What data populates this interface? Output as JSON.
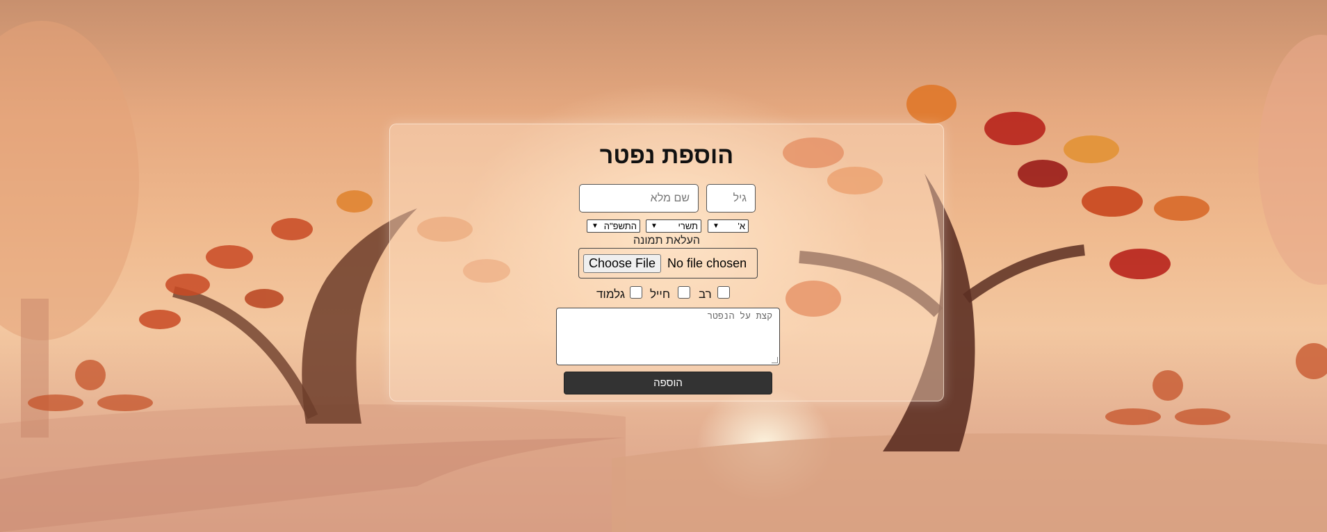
{
  "form": {
    "title": "הוספת נפטר",
    "full_name_placeholder": "שם מלא",
    "age_placeholder": "גיל",
    "day_value": "א'",
    "month_value": "תשרי",
    "year_value": "התשפ\"ה",
    "upload_label": "העלאת תמונה",
    "file_button_label": "Choose File",
    "file_status": "No file chosen",
    "checkbox_rav_label": "רב",
    "checkbox_soldier_label": "חייל",
    "checkbox_galmud_label": "גלמוד",
    "about_placeholder": "קצת על הנפטר",
    "submit_label": "הוספה"
  },
  "colors": {
    "submit_bg": "#333333",
    "submit_text": "#ffffff",
    "card_tint": "#ffe2c8"
  }
}
